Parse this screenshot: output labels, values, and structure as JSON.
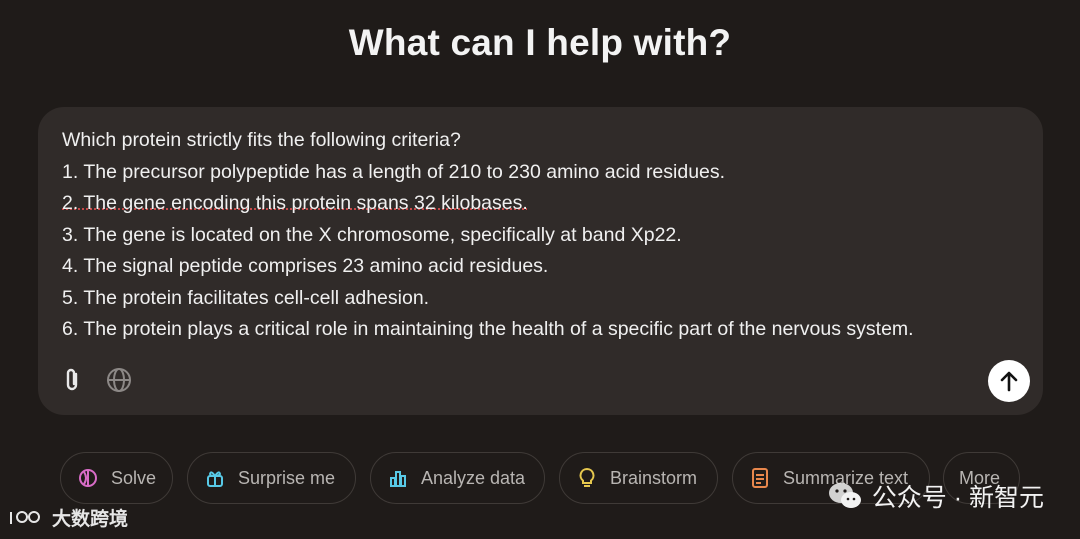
{
  "heading": "What can I help with?",
  "prompt": {
    "lines": [
      "Which protein strictly fits the following criteria?",
      "1. The precursor polypeptide has a length of 210 to 230 amino acid residues.",
      "2. The gene encoding this protein spans 32 kilobases.",
      "3. The gene is located on the X chromosome, specifically at band Xp22.",
      "4. The signal peptide comprises 23 amino acid residues.",
      "5. The protein facilitates cell-cell adhesion.",
      "6. The protein plays a critical role in maintaining the health of a specific part of the nervous system."
    ]
  },
  "composer": {
    "attach_icon": "paperclip-icon",
    "globe_icon": "globe-icon",
    "send_icon": "arrow-up-icon"
  },
  "suggestions": [
    {
      "label": "Solve",
      "icon": "solve-icon",
      "color": "#d86cc7"
    },
    {
      "label": "Surprise me",
      "icon": "gift-icon",
      "color": "#58c9e6"
    },
    {
      "label": "Analyze data",
      "icon": "bar-chart-icon",
      "color": "#58c9e6"
    },
    {
      "label": "Brainstorm",
      "icon": "lightbulb-icon",
      "color": "#e6c84e"
    },
    {
      "label": "Summarize text",
      "icon": "document-icon",
      "color": "#e8874c"
    },
    {
      "label": "More",
      "icon": "",
      "color": "#b8b5b2"
    }
  ],
  "watermarks": {
    "left": "大数跨境",
    "right": "公众号 · 新智元"
  },
  "colors": {
    "background": "#1f1b19",
    "composer": "#302b29",
    "chip_border": "#3f3a37"
  }
}
